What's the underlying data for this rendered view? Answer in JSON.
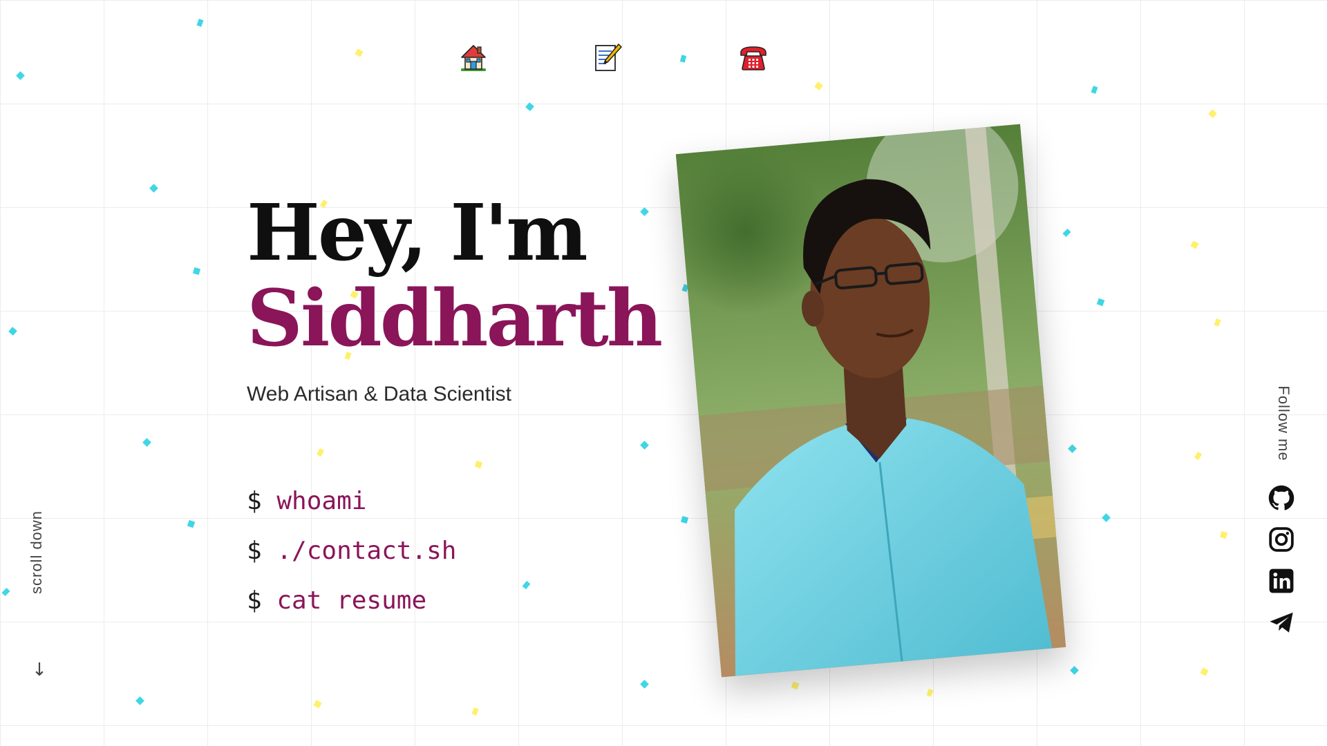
{
  "nav": {
    "items": [
      {
        "name": "home",
        "icon": "house-icon"
      },
      {
        "name": "resume",
        "icon": "memo-icon"
      },
      {
        "name": "contact",
        "icon": "telephone-icon"
      }
    ]
  },
  "hero": {
    "greeting": "Hey, I'm",
    "name": "Siddharth",
    "tagline": "Web Artisan & Data Scientist"
  },
  "commands": [
    {
      "prompt": "$",
      "text": "whoami"
    },
    {
      "prompt": "$",
      "text": "./contact.sh"
    },
    {
      "prompt": "$",
      "text": "cat resume"
    }
  ],
  "photo": {
    "alt": "Portrait of Siddharth"
  },
  "follow": {
    "label": "Follow me",
    "links": [
      {
        "name": "github",
        "icon": "github-icon"
      },
      {
        "name": "instagram",
        "icon": "instagram-icon"
      },
      {
        "name": "linkedin",
        "icon": "linkedin-icon"
      },
      {
        "name": "telegram",
        "icon": "telegram-icon"
      }
    ]
  },
  "scroll": {
    "label": "scroll down",
    "arrow": "↓"
  },
  "colors": {
    "accent": "#8a1559",
    "confetti_cyan": "#3fd6e6",
    "confetti_yellow": "#fff06a",
    "grid": "#ececec"
  }
}
